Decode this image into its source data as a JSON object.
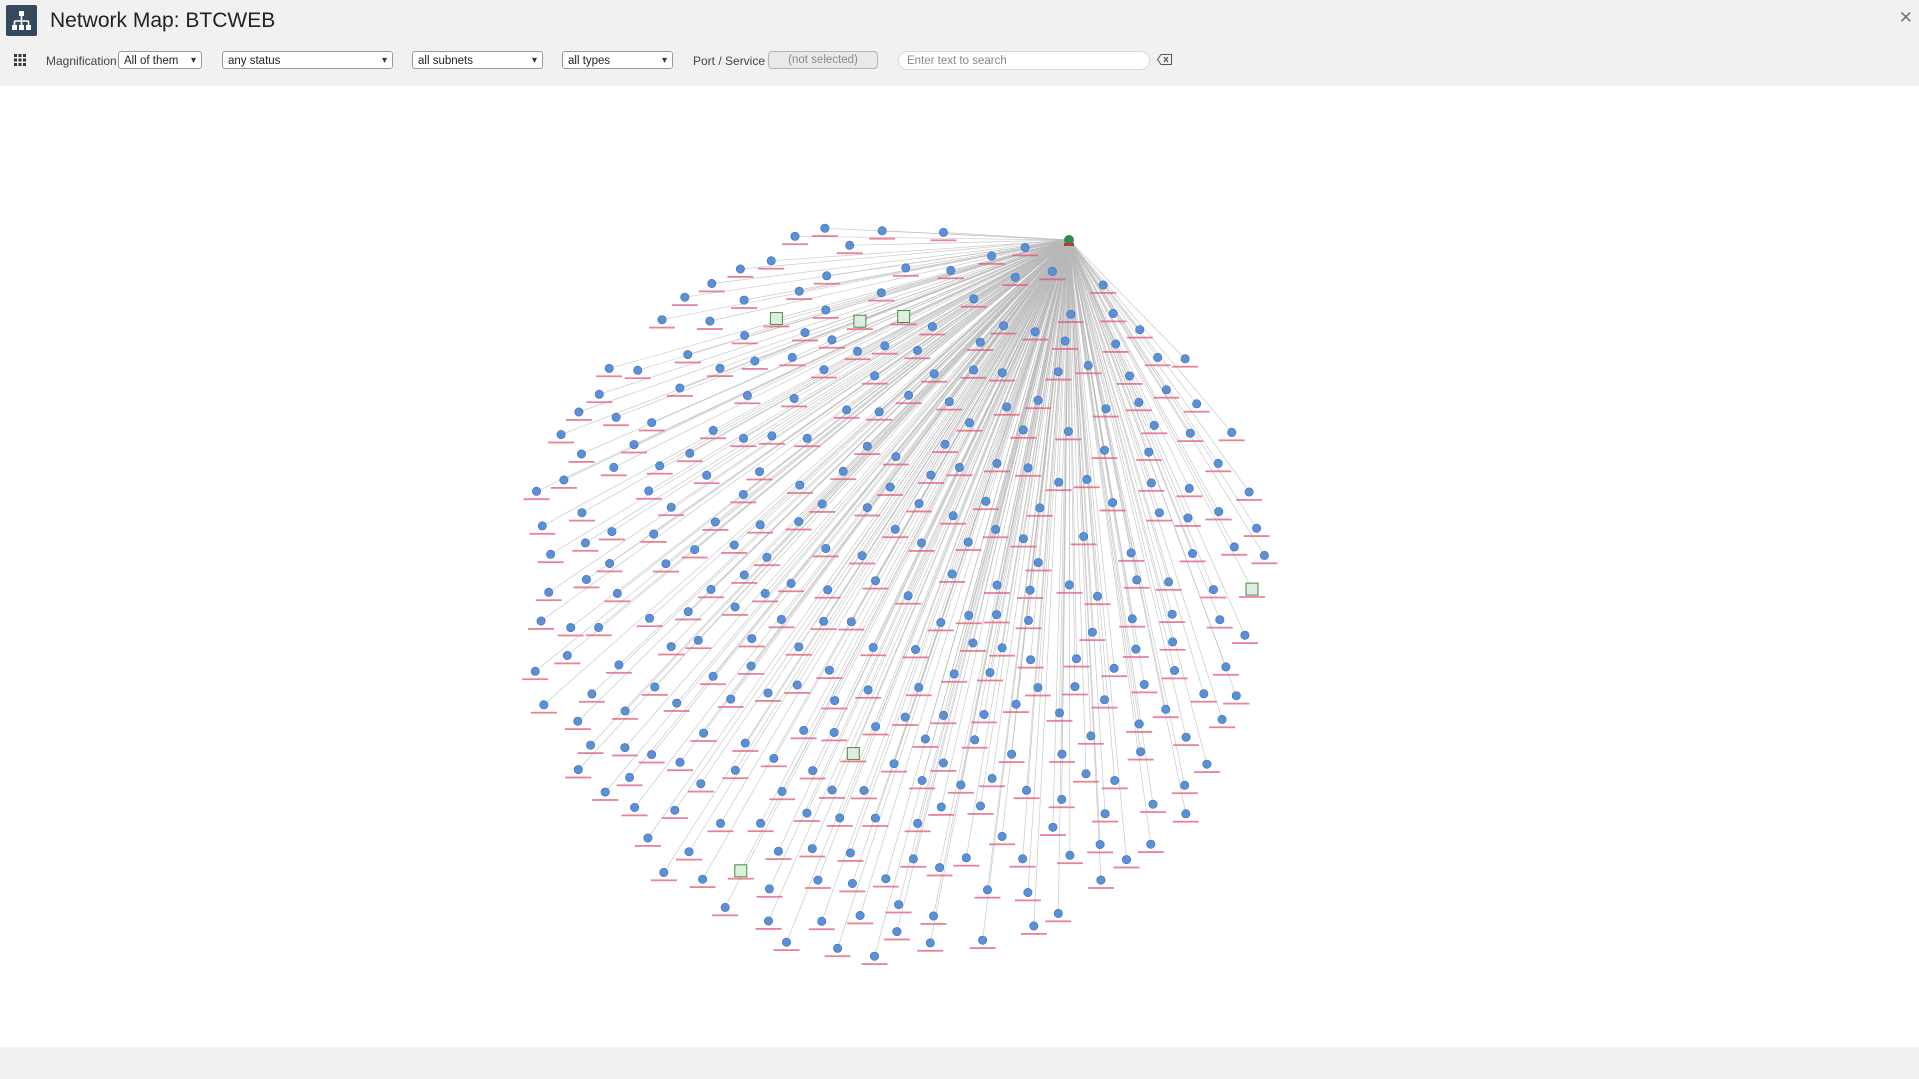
{
  "window": {
    "title": "Network Map: BTCWEB",
    "icons": {
      "app": "network-tree-icon",
      "close": "close-icon"
    }
  },
  "toolbar": {
    "grid_icon": "apps-grid-icon",
    "magnification_label": "Magnification",
    "magnification_value": "All of them",
    "status_value": "any status",
    "subnets_value": "all subnets",
    "types_value": "all types",
    "port_label": "Port / Service",
    "port_value": "(not selected)",
    "search_placeholder": "Enter text to search",
    "search_value": "",
    "clear_icon": "clear-search-icon"
  },
  "map": {
    "hub_color": "#2e8b57",
    "node_color": "#5b8fd6",
    "label_color": "#e0577a",
    "edge_color": "#b8b8b8",
    "server_color": "#4a8a3a",
    "node_count": 330,
    "server_count": 6
  }
}
